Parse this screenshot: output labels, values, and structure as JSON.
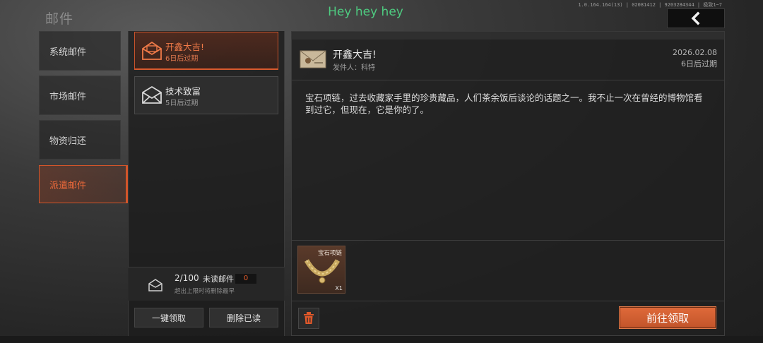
{
  "header": {
    "section_title": "邮件",
    "banner_text": "Hey hey hey",
    "version_text": "1.0.164.164(13) | 02081412 | 9203284344 | 极致1~7"
  },
  "categories": [
    {
      "label": "系统邮件",
      "active": false
    },
    {
      "label": "市场邮件",
      "active": false
    },
    {
      "label": "物资归还",
      "active": false
    },
    {
      "label": "派遣邮件",
      "active": true
    }
  ],
  "mails": [
    {
      "title": "开鑫大吉!",
      "expire": "6日后过期",
      "active": true,
      "icon": "open-envelope-icon"
    },
    {
      "title": "技术致富",
      "expire": "5日后过期",
      "active": false,
      "icon": "envelope-icon"
    }
  ],
  "quota": {
    "count": "2/100",
    "label": "未读邮件",
    "unread": "0",
    "hint": "超出上限时将删除最早"
  },
  "list_actions": {
    "claim_all": "一键领取",
    "delete_read": "删除已读"
  },
  "detail": {
    "title": "开鑫大吉!",
    "sender": "发件人：科特",
    "date": "2026.02.08",
    "expire": "6日后过期",
    "body": "宝石项链，过去收藏家手里的珍贵藏品，人们茶余饭后谈论的话题之一。我不止一次在曾经的博物馆看到过它，但现在，它是你的了。",
    "reward": {
      "name": "宝石项链",
      "qty": "X1"
    },
    "claim_button": "前往领取"
  },
  "colors": {
    "accent": "#d95a2e",
    "banner": "#4ecb80"
  }
}
